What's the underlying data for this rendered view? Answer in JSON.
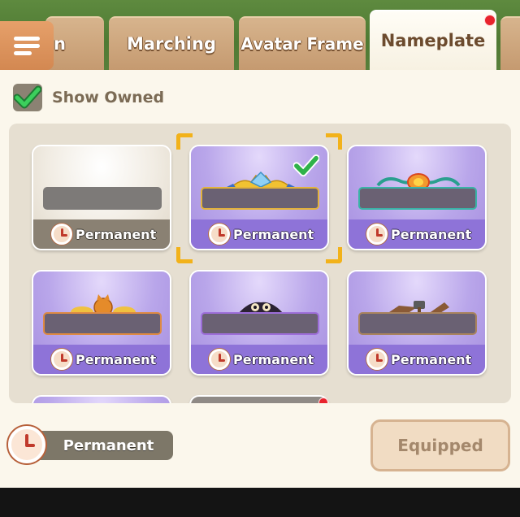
{
  "tabs": [
    {
      "label": "n"
    },
    {
      "label": "Marching"
    },
    {
      "label": "Avatar Frame"
    },
    {
      "label": "Nameplate",
      "active": true,
      "has_notification": true
    },
    {
      "label": ""
    }
  ],
  "filter": {
    "show_owned_label": "Show Owned",
    "show_owned_checked": true
  },
  "nameplates": [
    {
      "duration": "Permanent",
      "style": "white",
      "selected": false,
      "equipped": false
    },
    {
      "duration": "Permanent",
      "style": "gold-crown",
      "selected": true,
      "equipped": true
    },
    {
      "duration": "Permanent",
      "style": "teal-flame",
      "selected": false,
      "equipped": false
    },
    {
      "duration": "Permanent",
      "style": "gold-cat",
      "selected": false,
      "equipped": false
    },
    {
      "duration": "Permanent",
      "style": "purple-owl",
      "selected": false,
      "equipped": false
    },
    {
      "duration": "Permanent",
      "style": "brown-hammer",
      "selected": false,
      "equipped": false
    }
  ],
  "footer": {
    "duration_label": "Permanent",
    "equip_button_label": "Equipped"
  },
  "colors": {
    "tab_bg": "#c59a70",
    "tab_active_bg": "#fbf7ec",
    "card_purple": "#a790e0",
    "card_footer_purple": "#8e73d8",
    "selection_corner": "#f2b21a",
    "check_green": "#2fb24a",
    "notification_red": "#e8232d"
  },
  "icons": {
    "menu": "menu-icon",
    "checkbox": "checkmark-icon",
    "duration": "clock-icon",
    "equipped": "checkmark-icon"
  }
}
